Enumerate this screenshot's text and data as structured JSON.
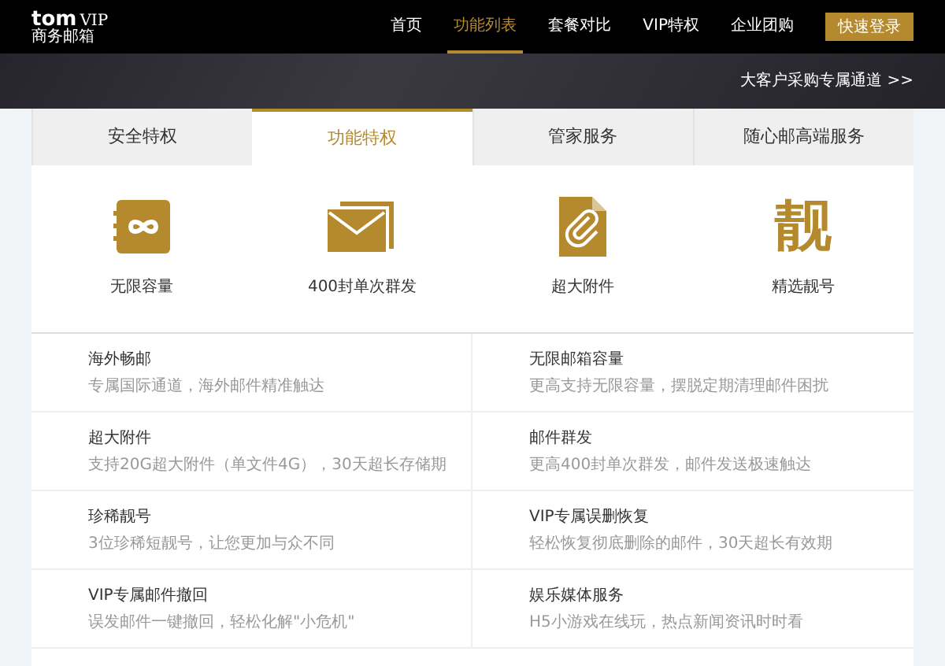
{
  "logo": {
    "brand": "tom",
    "tag": "VIP",
    "subtitle": "商务邮箱"
  },
  "nav": [
    {
      "label": "首页",
      "selected": false
    },
    {
      "label": "功能列表",
      "selected": true
    },
    {
      "label": "套餐对比",
      "selected": false
    },
    {
      "label": "VIP特权",
      "selected": false
    },
    {
      "label": "企业团购",
      "selected": false
    }
  ],
  "login_button": "快速登录",
  "enterprise_link": "大客户采购专属通道 >>",
  "tabs": [
    {
      "label": "安全特权",
      "selected": false
    },
    {
      "label": "功能特权",
      "selected": true
    },
    {
      "label": "管家服务",
      "selected": false
    },
    {
      "label": "随心邮高端服务",
      "selected": false
    }
  ],
  "highlights": [
    {
      "kind": "infinity",
      "label": "无限容量"
    },
    {
      "kind": "mail",
      "label": "400封单次群发"
    },
    {
      "kind": "attachment",
      "label": "超大附件"
    },
    {
      "kind": "glyph",
      "glyph": "靓",
      "label": "精选靓号"
    }
  ],
  "features": [
    {
      "title": "海外畅邮",
      "description": "专属国际通道，海外邮件精准触达"
    },
    {
      "title": "无限邮箱容量",
      "description": "更高支持无限容量，摆脱定期清理邮件困扰"
    },
    {
      "title": "超大附件",
      "description": "支持20G超大附件（单文件4G），30天超长存储期"
    },
    {
      "title": "邮件群发",
      "description": "更高400封单次群发，邮件发送极速触达"
    },
    {
      "title": "珍稀靓号",
      "description": "3位珍稀短靓号，让您更加与众不同"
    },
    {
      "title": "VIP专属误删恢复",
      "description": "轻松恢复彻底删除的邮件，30天超长有效期"
    },
    {
      "title": "VIP专属邮件撤回",
      "description": "误发邮件一键撤回，轻松化解\"小危机\""
    },
    {
      "title": "娱乐媒体服务",
      "description": "H5小游戏在线玩，热点新闻资讯时时看"
    }
  ]
}
